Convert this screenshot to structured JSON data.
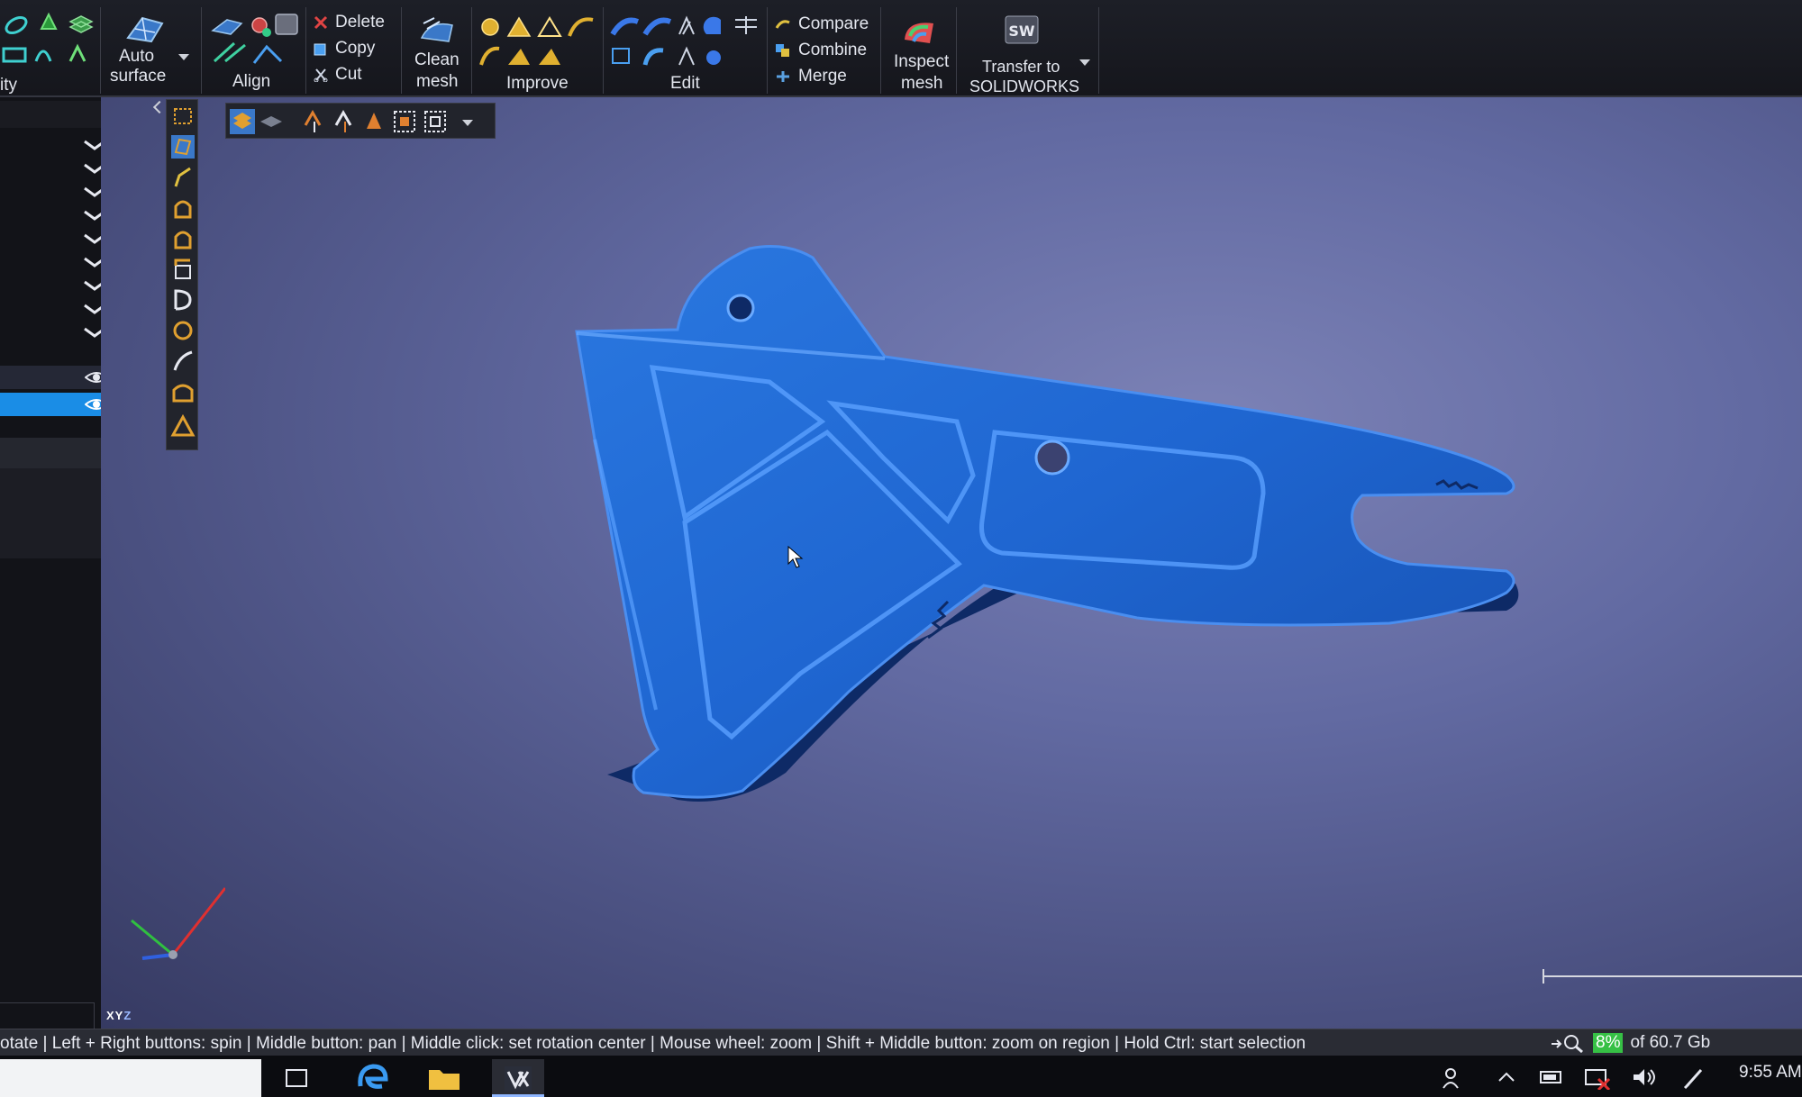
{
  "ribbon": {
    "partial_group_label": "ity",
    "auto_surface": {
      "line1": "Auto",
      "line2": "surface"
    },
    "align": {
      "label": "Align"
    },
    "edit_small": [
      {
        "label": "Delete",
        "icon": "delete-x-icon",
        "color": "#e04444"
      },
      {
        "label": "Copy",
        "icon": "copy-icon",
        "color": "#4a9ff0"
      },
      {
        "label": "Cut",
        "icon": "cut-scissors-icon",
        "color": "#cfd6e4"
      }
    ],
    "clean_mesh": {
      "line1": "Clean",
      "line2": "mesh"
    },
    "improve": {
      "label": "Improve"
    },
    "edit": {
      "label": "Edit"
    },
    "combine_small": [
      {
        "label": "Compare",
        "icon": "compare-icon",
        "color": "#e0c040"
      },
      {
        "label": "Combine",
        "icon": "combine-icon",
        "color": "#4a9ff0"
      },
      {
        "label": "Merge",
        "icon": "merge-icon",
        "color": "#5aa0e0"
      }
    ],
    "inspect_mesh": {
      "line1": "Inspect",
      "line2": "mesh"
    },
    "transfer": {
      "line1": "Transfer to",
      "line2": "SOLIDWORKS"
    }
  },
  "viewport": {
    "background_color": "#626aa2",
    "mesh_color": "#1f66d1",
    "axis_label": {
      "x": "X",
      "y": "Y",
      "z": "Z"
    }
  },
  "status": {
    "hints": "otate  |  Left + Right buttons: spin  |  Middle button: pan  |  Middle click: set rotation center  |  Mouse wheel: zoom  |  Shift + Middle button: zoom on region  |  Hold Ctrl: start selection",
    "memory_percent": "8%",
    "memory_total": "of 60.7 Gb"
  },
  "taskbar": {
    "clock": "9:55 AM",
    "accent": "#8fb6ff"
  }
}
